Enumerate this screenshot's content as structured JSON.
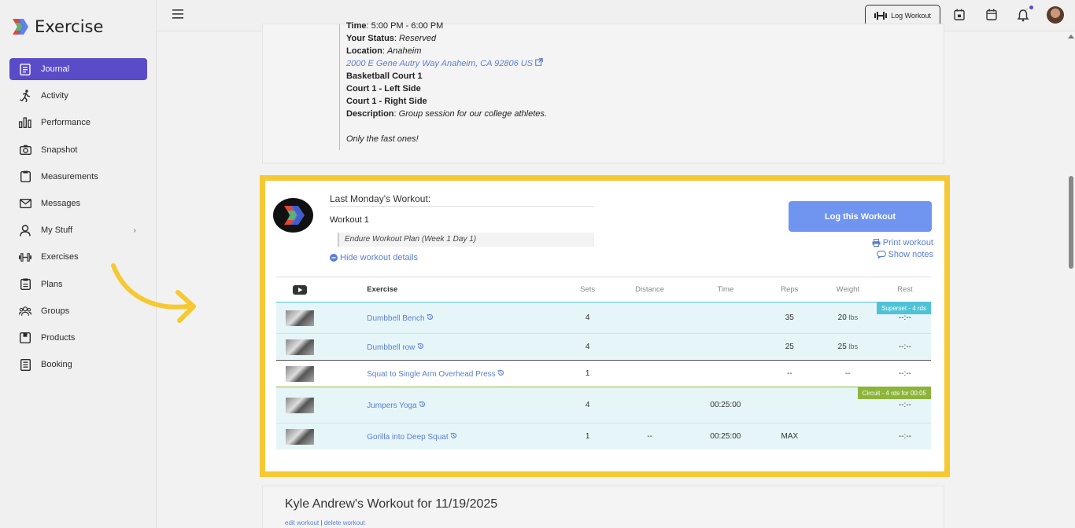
{
  "app": {
    "name": "Exercise"
  },
  "sidebar": {
    "items": [
      {
        "label": "Journal",
        "icon": "journal-icon",
        "active": true
      },
      {
        "label": "Activity",
        "icon": "running-icon"
      },
      {
        "label": "Performance",
        "icon": "bar-chart-icon"
      },
      {
        "label": "Snapshot",
        "icon": "camera-icon"
      },
      {
        "label": "Measurements",
        "icon": "clipboard-icon"
      },
      {
        "label": "Messages",
        "icon": "mail-icon"
      },
      {
        "label": "My Stuff",
        "icon": "user-icon",
        "has_submenu": true
      },
      {
        "label": "Exercises",
        "icon": "dumbbell-icon"
      },
      {
        "label": "Plans",
        "icon": "clipboard-list-icon"
      },
      {
        "label": "Groups",
        "icon": "group-icon"
      },
      {
        "label": "Products",
        "icon": "box-icon"
      },
      {
        "label": "Booking",
        "icon": "book-icon"
      }
    ]
  },
  "topbar": {
    "log_workout_label": "Log Workout"
  },
  "event": {
    "time_label": "Time",
    "time_value": "5:00 PM - 6:00 PM",
    "status_label": "Your Status",
    "status_value": "Reserved",
    "location_label": "Location",
    "location_value": "Anaheim",
    "address": "2000 E Gene Autry Way Anaheim, CA 92806 US",
    "court1": "Basketball Court 1",
    "court2": "Court 1 - Left Side",
    "court3": "Court 1 - Right Side",
    "description_label": "Description",
    "description_value": "Group session for our college athletes.",
    "note": "Only the fast ones!"
  },
  "workout": {
    "title": "Last Monday's Workout:",
    "name": "Workout 1",
    "plan": "Endure Workout Plan (Week 1 Day 1)",
    "hide_details": "Hide workout details",
    "log_this": "Log this Workout",
    "print": "Print workout",
    "show_notes": "Show notes",
    "columns": [
      "Exercise",
      "Sets",
      "Distance",
      "Time",
      "Reps",
      "Weight",
      "Rest"
    ],
    "rows": [
      {
        "exercise": "Dumbbell Bench",
        "sets": "4",
        "distance": "",
        "time": "",
        "reps": "35",
        "weight": "20",
        "unit": "lbs",
        "rest": "--:--",
        "tag": "Superset - 4 rds"
      },
      {
        "exercise": "Dumbbell row",
        "sets": "4",
        "distance": "",
        "time": "",
        "reps": "25",
        "weight": "25",
        "unit": "lbs",
        "rest": "--:--"
      },
      {
        "exercise": "Squat to Single Arm Overhead Press",
        "sets": "1",
        "distance": "",
        "time": "",
        "reps": "--",
        "weight": "--",
        "unit": "",
        "rest": "--:--"
      },
      {
        "exercise": "Jumpers Yoga",
        "sets": "4",
        "distance": "",
        "time": "00:25:00",
        "reps": "",
        "weight": "",
        "unit": "",
        "rest": "--:--",
        "tag": "Circuit - 4 rds for 00:05"
      },
      {
        "exercise": "Gorilla into Deep Squat",
        "sets": "1",
        "distance": "--",
        "time": "00:25:00",
        "reps": "MAX",
        "weight": "",
        "unit": "",
        "rest": "--:--"
      }
    ]
  },
  "next": {
    "title": "Kyle Andrew's Workout for 11/19/2025",
    "edit": "edit workout",
    "delete": "delete workout"
  },
  "colors": {
    "accent": "#5a4bc9",
    "link": "#5b7fd6",
    "highlight": "#f6c832",
    "superset": "#4fc3d6",
    "circuit": "#8cb43a",
    "button": "#6f95f0"
  }
}
